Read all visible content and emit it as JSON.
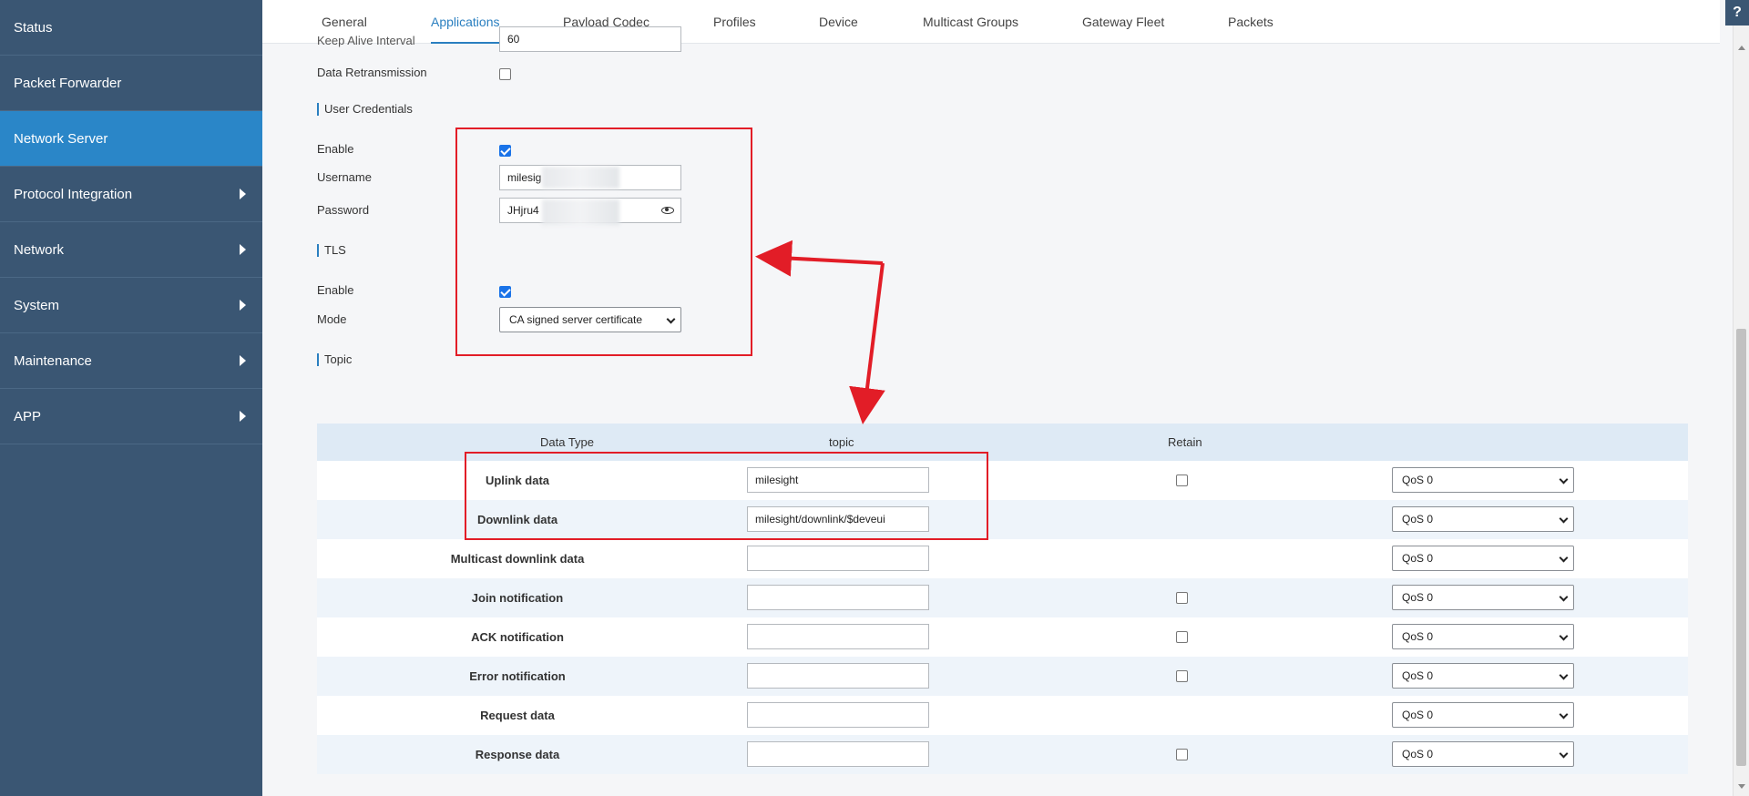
{
  "sidebar": {
    "items": [
      {
        "label": "Status",
        "active": false,
        "has_arrow": false
      },
      {
        "label": "Packet Forwarder",
        "active": false,
        "has_arrow": false
      },
      {
        "label": "Network Server",
        "active": true,
        "has_arrow": false
      },
      {
        "label": "Protocol Integration",
        "active": false,
        "has_arrow": true
      },
      {
        "label": "Network",
        "active": false,
        "has_arrow": true
      },
      {
        "label": "System",
        "active": false,
        "has_arrow": true
      },
      {
        "label": "Maintenance",
        "active": false,
        "has_arrow": true
      },
      {
        "label": "APP",
        "active": false,
        "has_arrow": true
      }
    ]
  },
  "tabs": [
    "General",
    "Applications",
    "Payload Codec",
    "Profiles",
    "Device",
    "Multicast Groups",
    "Gateway Fleet",
    "Packets"
  ],
  "active_tab": "Applications",
  "help_label": "?",
  "form": {
    "keepalive_label": "Keep Alive Interval",
    "keepalive_value": "60",
    "data_retransmission_label": "Data Retransmission",
    "data_retransmission_checked": false,
    "user_credentials_title": "User Credentials",
    "uc_enable_label": "Enable",
    "uc_enable_checked": true,
    "username_label": "Username",
    "username_value": "milesig",
    "password_label": "Password",
    "password_value": "JHjru4",
    "tls_title": "TLS",
    "tls_enable_label": "Enable",
    "tls_enable_checked": true,
    "mode_label": "Mode",
    "mode_value": "CA signed server certificate",
    "topic_title": "Topic"
  },
  "topic_table": {
    "headers": {
      "data_type": "Data Type",
      "topic": "topic",
      "retain": "Retain"
    },
    "rows": [
      {
        "label": "Uplink data",
        "topic": "milesight",
        "retain": true,
        "qos": "QoS 0"
      },
      {
        "label": "Downlink data",
        "topic": "milesight/downlink/$deveui",
        "retain": null,
        "qos": "QoS 0"
      },
      {
        "label": "Multicast downlink data",
        "topic": "",
        "retain": null,
        "qos": "QoS 0"
      },
      {
        "label": "Join notification",
        "topic": "",
        "retain": true,
        "qos": "QoS 0"
      },
      {
        "label": "ACK notification",
        "topic": "",
        "retain": true,
        "qos": "QoS 0"
      },
      {
        "label": "Error notification",
        "topic": "",
        "retain": true,
        "qos": "QoS 0"
      },
      {
        "label": "Request data",
        "topic": "",
        "retain": null,
        "qos": "QoS 0"
      },
      {
        "label": "Response data",
        "topic": "",
        "retain": true,
        "qos": "QoS 0"
      }
    ]
  },
  "colors": {
    "sidebar_bg": "#3a5673",
    "sidebar_active": "#2a86c8",
    "accent": "#2a7fc0",
    "annotation_red": "#e21d27"
  }
}
